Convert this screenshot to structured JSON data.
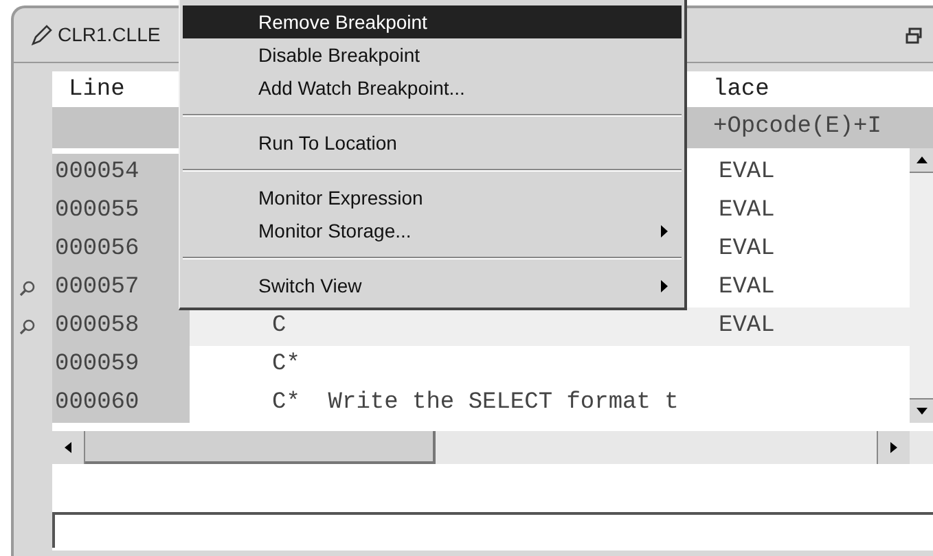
{
  "editor_tab": {
    "title": "CLR1.CLLE"
  },
  "columns": {
    "line": "Line",
    "column_2": "lace",
    "ruler": "+Opcode(E)+I"
  },
  "rows": [
    {
      "line": "000054",
      "code": "",
      "opcode": "EVAL",
      "breakpoint": false,
      "selected": false
    },
    {
      "line": "000055",
      "code": "",
      "opcode": "EVAL",
      "breakpoint": false,
      "selected": false
    },
    {
      "line": "000056",
      "code": "",
      "opcode": "EVAL",
      "breakpoint": false,
      "selected": false
    },
    {
      "line": "000057",
      "code": "",
      "opcode": "EVAL",
      "breakpoint": true,
      "selected": false
    },
    {
      "line": "000058",
      "code": "C",
      "opcode": "EVAL",
      "breakpoint": true,
      "selected": true
    },
    {
      "line": "000059",
      "code": "C*",
      "opcode": "",
      "breakpoint": false,
      "selected": false
    },
    {
      "line": "000060",
      "code": "C*  Write the SELECT format t",
      "opcode": "",
      "breakpoint": false,
      "selected": false
    }
  ],
  "context_menu": [
    {
      "kind": "item",
      "label": "Remove Breakpoint",
      "selected": true,
      "submenu": false
    },
    {
      "kind": "item",
      "label": "Disable Breakpoint",
      "selected": false,
      "submenu": false
    },
    {
      "kind": "item",
      "label": "Add Watch Breakpoint...",
      "selected": false,
      "submenu": false
    },
    {
      "kind": "separator"
    },
    {
      "kind": "item",
      "label": "Run To Location",
      "selected": false,
      "submenu": false
    },
    {
      "kind": "separator"
    },
    {
      "kind": "item",
      "label": "Monitor Expression",
      "selected": false,
      "submenu": false
    },
    {
      "kind": "item",
      "label": "Monitor Storage...",
      "selected": false,
      "submenu": true
    },
    {
      "kind": "separator"
    },
    {
      "kind": "item",
      "label": "Switch View",
      "selected": false,
      "submenu": true
    }
  ]
}
